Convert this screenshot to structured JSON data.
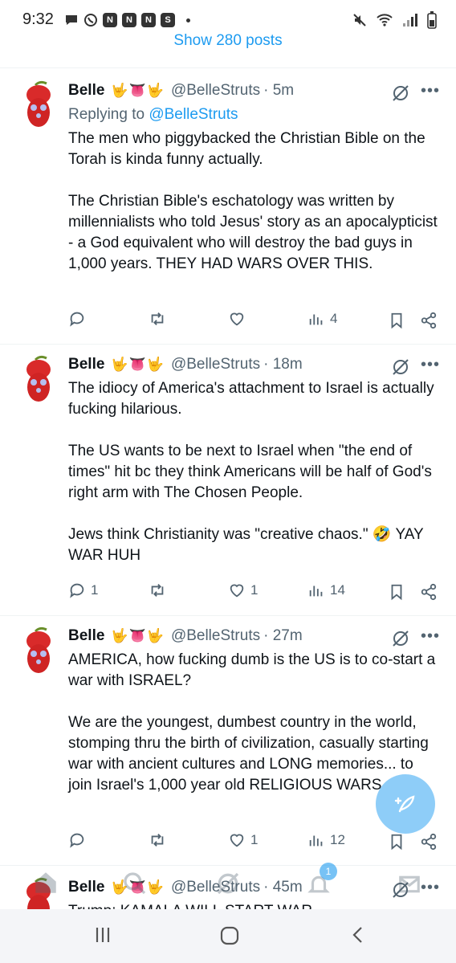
{
  "status_bar": {
    "time": "9:32",
    "notif_icons": [
      "chat-icon",
      "whatsapp-icon",
      "n-icon",
      "n-icon",
      "n-icon",
      "s-icon"
    ],
    "right_icons": [
      "mute-icon",
      "wifi-icon",
      "signal-icon",
      "battery-icon"
    ]
  },
  "feed": {
    "show_posts_label": "Show 280 posts"
  },
  "tweets": [
    {
      "name": "Belle",
      "emoji": "🤟👅🤟",
      "handle": "@BelleStruts",
      "time": "· 5m",
      "reply_prefix": "Replying to ",
      "reply_handle": "@BelleStruts",
      "text": "The men who piggybacked the Christian Bible on the Torah is kinda funny actually.\n\nThe Christian Bible's eschatology was written by millennialists who told Jesus' story as an apocalypticist - a God equivalent who will destroy the bad guys in 1,000 years. THEY HAD WARS OVER THIS.",
      "replies": "",
      "reposts": "",
      "likes": "",
      "views": "4"
    },
    {
      "name": "Belle",
      "emoji": "🤟👅🤟",
      "handle": "@BelleStruts",
      "time": "· 18m",
      "text": "The idiocy of America's attachment to Israel is actually fucking hilarious.\n\nThe US wants to be next to Israel when \"the end of times\" hit bc they think Americans will be half of God's right arm with The Chosen People.\n\nJews think Christianity was \"creative chaos.\" 🤣 YAY WAR HUH",
      "replies": "1",
      "reposts": "",
      "likes": "1",
      "views": "14"
    },
    {
      "name": "Belle",
      "emoji": "🤟👅🤟",
      "handle": "@BelleStruts",
      "time": "· 27m",
      "text": "AMERICA, how fucking dumb is the US is to co-start a war with ISRAEL?\n\nWe are the youngest, dumbest country in the world, stomping thru the birth of civilization, casually starting war with ancient cultures and LONG memories... to join Israel's 1,000 year old RELIGIOUS WARS. 😩",
      "replies": "",
      "reposts": "",
      "likes": "1",
      "views": "12"
    },
    {
      "name": "Belle",
      "emoji": "🤟👅🤟",
      "handle": "@BelleStruts",
      "time": "· 45m",
      "text": "Trump: KAMALA WILL START WAR"
    }
  ],
  "bottom_tabs": {
    "notifications_badge": "1"
  },
  "colors": {
    "accent": "#1d9bf0",
    "muted": "#536471",
    "fab": "#8ecdf8"
  }
}
